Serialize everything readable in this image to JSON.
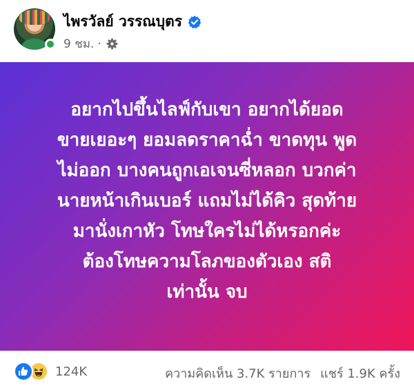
{
  "author": {
    "name": "ไพรวัลย์ วรรณบุตร",
    "verified": true,
    "time": "9 ชม.",
    "separator": "·",
    "audience_icon": "gear-icon"
  },
  "post": {
    "background": [
      "#5a31d6",
      "#8a2cb8",
      "#c41f82",
      "#f01658"
    ],
    "lines": [
      "อยากไปขึ้นไลฟ์กับเขา อยากได้ยอด",
      "ขายเยอะๆ ยอมลดราคาฉ่ำ ขาดทุน พูด",
      "ไม่ออก บางคนถูกเอเจนซี่หลอก บวกค่า",
      "นายหน้าเกินเบอร์ แถมไม่ได้คิว สุดท้าย",
      "มานั่งเกาหัว โทษใครไม่ได้หรอกค่ะ",
      "ต้องโทษความโลภของตัวเอง สติ",
      "เท่านั้น จบ"
    ]
  },
  "engagement": {
    "reaction_icons": [
      "like-icon",
      "haha-icon"
    ],
    "reaction_count": "124K",
    "comments": "ความคิดเห็น 3.7K รายการ",
    "shares": "แชร์ 1.9K ครั้ง"
  },
  "colors": {
    "verified": "#1877f2",
    "online": "#31a24c",
    "secondary_text": "#65676b"
  }
}
